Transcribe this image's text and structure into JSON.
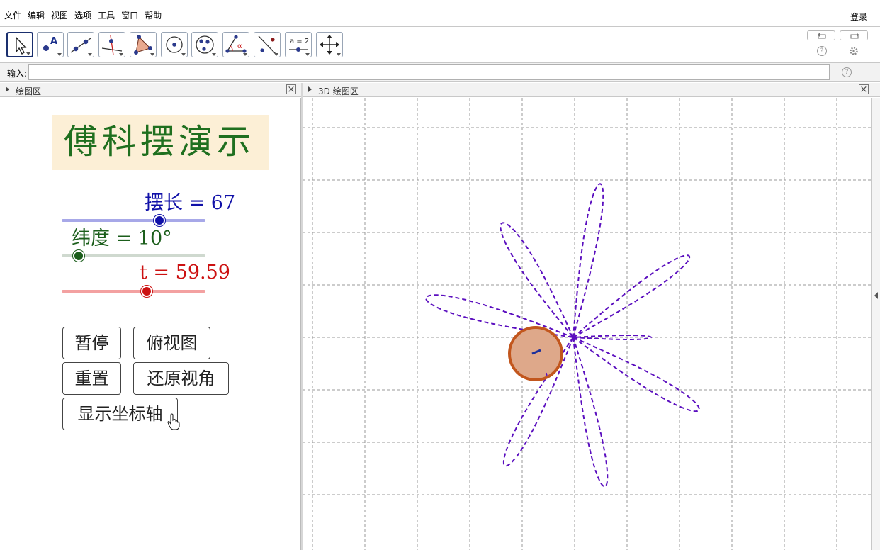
{
  "menu": {
    "items": [
      "文件",
      "编辑",
      "视图",
      "选项",
      "工具",
      "窗口",
      "帮助"
    ],
    "login": "登录"
  },
  "toolbar": {
    "tools": [
      {
        "name": "move-tool-icon"
      },
      {
        "name": "point-tool-icon",
        "label": "A"
      },
      {
        "name": "line-tool-icon"
      },
      {
        "name": "perpendicular-line-tool-icon"
      },
      {
        "name": "polygon-tool-icon"
      },
      {
        "name": "circle-tool-icon"
      },
      {
        "name": "conic-tool-icon"
      },
      {
        "name": "angle-tool-icon",
        "label": "α"
      },
      {
        "name": "reflect-tool-icon"
      },
      {
        "name": "slider-tool-icon",
        "label": "a = 2"
      },
      {
        "name": "move-view-tool-icon"
      }
    ],
    "undo_icon": "undo-icon",
    "redo_icon": "redo-icon",
    "help_icon": "help-icon",
    "settings_icon": "gear-icon"
  },
  "input_bar": {
    "label": "输入:",
    "value": "",
    "placeholder": ""
  },
  "left_panel": {
    "header": "绘图区",
    "title": "傅科摆演示",
    "sliders": [
      {
        "name": "摆长",
        "value": "67",
        "text": "摆长 = 67",
        "fraction": 0.68,
        "color": "#1010a8",
        "track_color": "#a7a8e8"
      },
      {
        "name": "纬度",
        "value": "10°",
        "text": "纬度 = 10°",
        "fraction": 0.12,
        "color": "#1b5e1b",
        "track_color": "#cfd9cf"
      },
      {
        "name": "t",
        "value": "59.59",
        "text": "t = 59.59",
        "fraction": 0.59,
        "color": "#cc1111",
        "track_color": "#f3a1a1"
      }
    ],
    "buttons": {
      "pause": "暂停",
      "top_view": "俯视图",
      "reset": "重置",
      "restore_view": "还原视角",
      "show_axes": "显示坐标轴"
    }
  },
  "right_panel": {
    "header": "3D 绘图区",
    "trace_color": "#5b0fbf",
    "bob_fill": "#dea88a",
    "bob_stroke": "#c2561d",
    "grid_color": "#9a9a9a"
  }
}
